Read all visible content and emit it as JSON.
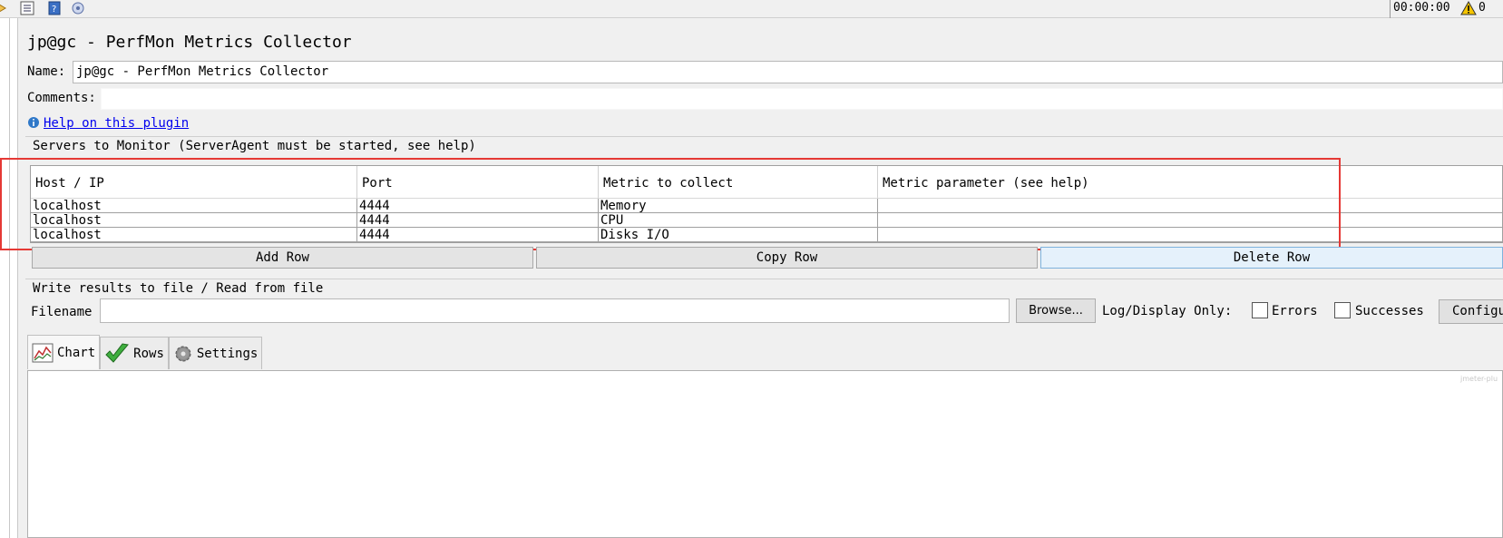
{
  "toolbar": {
    "timer": "00:00:00",
    "warning_count": "0"
  },
  "panel": {
    "title": "jp@gc - PerfMon Metrics Collector",
    "name_label": "Name:",
    "name_value": "jp@gc - PerfMon Metrics Collector",
    "comments_label": "Comments:",
    "comments_value": "",
    "help_link": "Help on this plugin"
  },
  "servers": {
    "group_title": "Servers to Monitor (ServerAgent must be started, see help)",
    "columns": [
      "Host / IP",
      "Port",
      "Metric to collect",
      "Metric parameter (see help)"
    ],
    "rows": [
      [
        "localhost",
        "4444",
        "Memory",
        ""
      ],
      [
        "localhost",
        "4444",
        "CPU",
        ""
      ],
      [
        "localhost",
        "4444",
        "Disks I/O",
        ""
      ]
    ],
    "buttons": {
      "add": "Add Row",
      "copy": "Copy Row",
      "delete": "Delete Row"
    }
  },
  "file": {
    "group_title": "Write results to file / Read from file",
    "filename_label": "Filename",
    "filename_value": "",
    "browse": "Browse...",
    "log_label": "Log/Display Only:",
    "errors_label": "Errors",
    "errors_checked": false,
    "successes_label": "Successes",
    "successes_checked": false,
    "configure": "Configure"
  },
  "tabs": [
    {
      "label": "Chart",
      "icon": "line-chart-icon",
      "active": true
    },
    {
      "label": "Rows",
      "icon": "checkmark-icon",
      "active": false
    },
    {
      "label": "Settings",
      "icon": "gear-icon",
      "active": false
    }
  ],
  "chart_watermark": "jmeter-plu"
}
